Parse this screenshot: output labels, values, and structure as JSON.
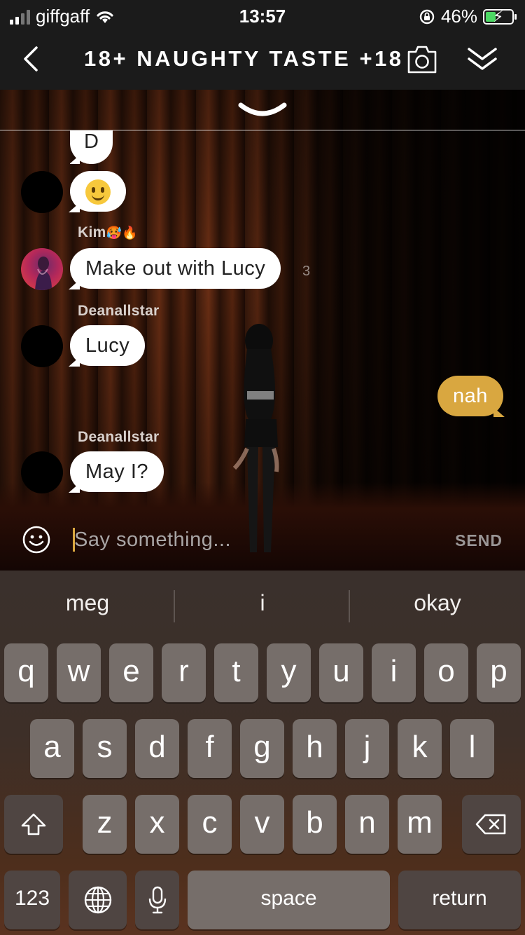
{
  "status_bar": {
    "carrier": "giffgaff",
    "time": "13:57",
    "battery": "46%",
    "battery_level": 0.46
  },
  "header": {
    "title": "18+ NAUGHTY TASTE +18"
  },
  "chat": {
    "messages": [
      {
        "text": "D",
        "direction": "incoming"
      },
      {
        "emoji": "slightly-smiling-face",
        "direction": "incoming"
      },
      {
        "sender": "Kim",
        "sender_emojis": "🥵🔥",
        "text": "Make out with Lucy",
        "partial": "3",
        "direction": "incoming"
      },
      {
        "sender": "Deanallstar",
        "text": "Lucy",
        "direction": "incoming"
      },
      {
        "text": "nah",
        "direction": "outgoing"
      },
      {
        "sender": "Deanallstar",
        "text": "May I?",
        "direction": "incoming"
      }
    ]
  },
  "input": {
    "placeholder": "Say something...",
    "send_label": "SEND"
  },
  "keyboard": {
    "suggestions": [
      "meg",
      "i",
      "okay"
    ],
    "row1": [
      "q",
      "w",
      "e",
      "r",
      "t",
      "y",
      "u",
      "i",
      "o",
      "p"
    ],
    "row2": [
      "a",
      "s",
      "d",
      "f",
      "g",
      "h",
      "j",
      "k",
      "l"
    ],
    "row3": [
      "z",
      "x",
      "c",
      "v",
      "b",
      "n",
      "m"
    ],
    "numbers_label": "123",
    "space_label": "space",
    "return_label": "return"
  },
  "colors": {
    "accent": "#d9a740",
    "header_bg": "#1b1b1b",
    "keyboard_key": "#766e6a"
  }
}
